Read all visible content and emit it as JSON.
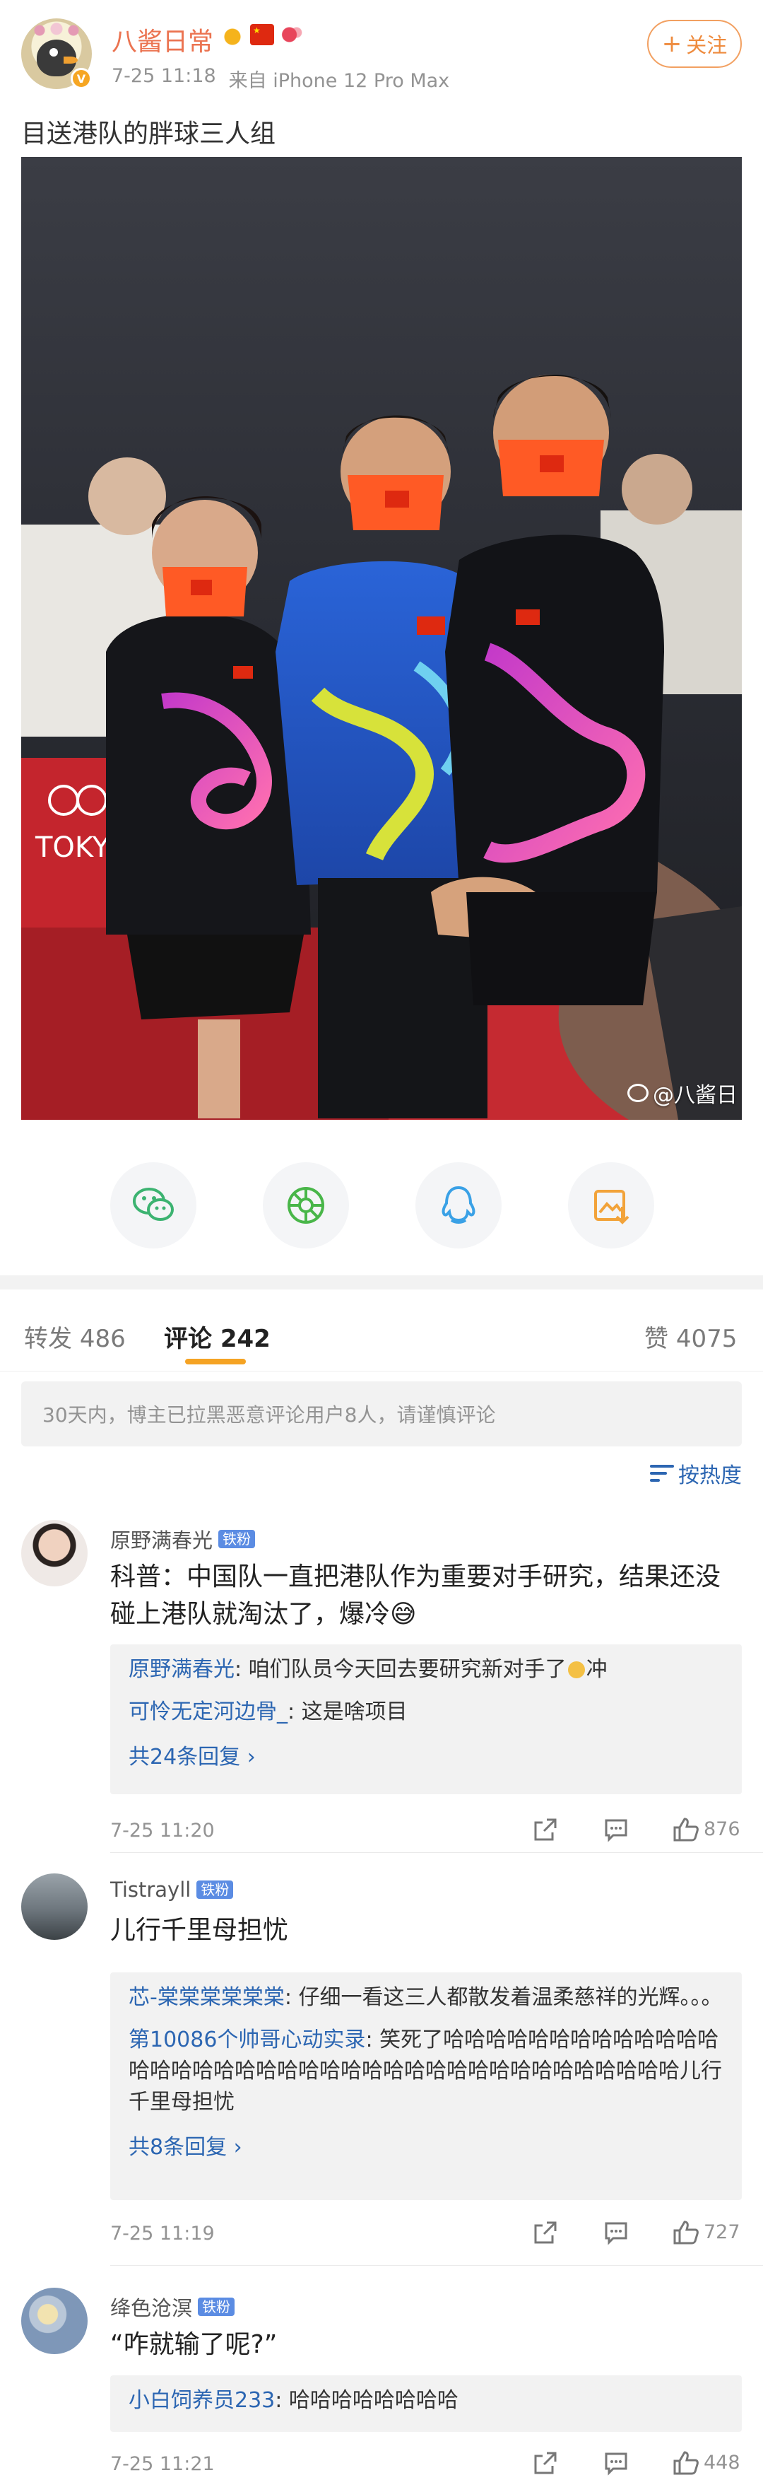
{
  "post": {
    "username": "八酱日常",
    "time": "7-25 11:18",
    "source": "来自 iPhone 12 Pro Max",
    "follow_label": "关注",
    "follow_plus": "+",
    "text": "目送港队的胖球三人组",
    "watermark": "@八酱日"
  },
  "share": {
    "icons": [
      "wechat-icon",
      "moments-icon",
      "qq-icon",
      "save-image-icon"
    ],
    "colors": {
      "wechat": "#3cb371",
      "moments": "#49b649",
      "qq": "#3aa1e6",
      "save": "#f2a33a"
    }
  },
  "tabs": {
    "repost_label": "转发",
    "repost_count": "486",
    "comment_label": "评论",
    "comment_count": "242",
    "like_label": "赞",
    "like_count": "4075"
  },
  "notice": "30天内，博主已拉黑恶意评论用户8人，请谨慎评论",
  "sort_label": "按热度",
  "comments": [
    {
      "name": "原野满春光",
      "badge": "铁粉",
      "text": "科普：中国队一直把港队作为重要对手研究，结果还没碰上港队就淘汰了，爆冷😅",
      "replies": [
        {
          "name": "原野满春光",
          "text": ": 咱们队员今天回去要研究新对手了",
          "suffix": "冲"
        },
        {
          "name": "可怜无定河边骨_",
          "text": ": 这是啥项目"
        }
      ],
      "more": "共24条回复",
      "time": "7-25 11:20",
      "likes": "876"
    },
    {
      "name": "Tistrayll",
      "badge": "铁粉",
      "text": "儿行千里母担忧",
      "replies": [
        {
          "name": "芯-棠棠棠棠棠棠",
          "text": ": 仔细一看这三人都散发着温柔慈祥的光辉。。。"
        },
        {
          "name": "第10086个帅哥心动实录",
          "text": ": 笑死了哈哈哈哈哈哈哈哈哈哈哈哈哈哈哈哈哈哈哈哈哈哈哈哈哈哈哈哈哈哈哈哈哈哈哈哈哈哈哈儿行千里母担忧"
        }
      ],
      "more": "共8条回复",
      "time": "7-25 11:19",
      "likes": "727"
    },
    {
      "name": "绛色沧溟",
      "badge": "铁粉",
      "text": "“咋就输了呢?”",
      "replies": [
        {
          "name": "小白饲养员233",
          "text": ": 哈哈哈哈哈哈哈哈"
        }
      ],
      "time": "7-25 11:21",
      "likes": "448"
    }
  ]
}
